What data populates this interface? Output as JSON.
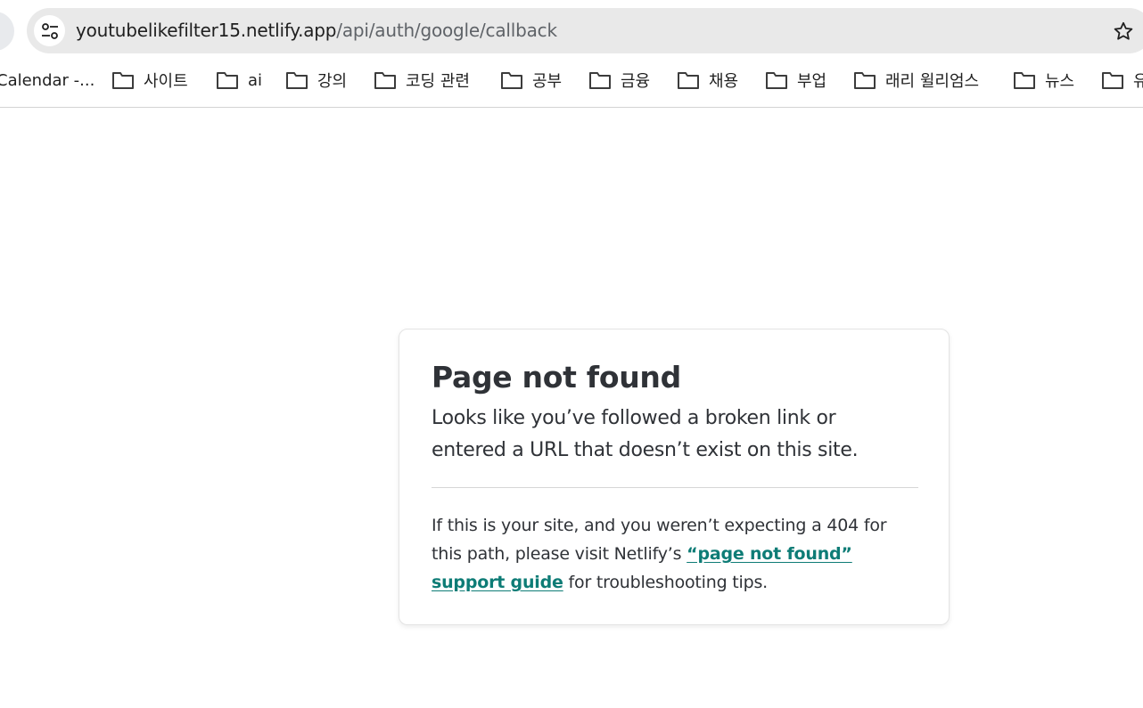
{
  "browser": {
    "url_host": "youtubelikefilter15.netlify.app",
    "url_path": "/api/auth/google/callback",
    "site_info_icon": "tune-icon",
    "bookmark_star_icon": "star-icon",
    "bookmarks": [
      {
        "label": "Calendar -...",
        "icon": "calendar-favicon"
      },
      {
        "label": "사이트",
        "icon": "folder-icon"
      },
      {
        "label": "ai",
        "icon": "folder-icon"
      },
      {
        "label": "강의",
        "icon": "folder-icon"
      },
      {
        "label": "코딩 관련",
        "icon": "folder-icon"
      },
      {
        "label": "공부",
        "icon": "folder-icon"
      },
      {
        "label": "금융",
        "icon": "folder-icon"
      },
      {
        "label": "채용",
        "icon": "folder-icon"
      },
      {
        "label": "부업",
        "icon": "folder-icon"
      },
      {
        "label": "래리 윌리엄스",
        "icon": "folder-icon"
      },
      {
        "label": "뉴스",
        "icon": "folder-icon"
      },
      {
        "label": "유",
        "icon": "folder-icon"
      }
    ]
  },
  "page": {
    "title": "Page not found",
    "lead": "Looks like you’ve followed a broken link or entered a URL that doesn’t exist on this site.",
    "note_before": "If this is your site, and you weren’t expecting a 404 for this path, please visit Netlify’s ",
    "note_link": "“page not found” support guide",
    "note_after": " for troubleshooting tips.",
    "link_color": "#0e7c76"
  }
}
